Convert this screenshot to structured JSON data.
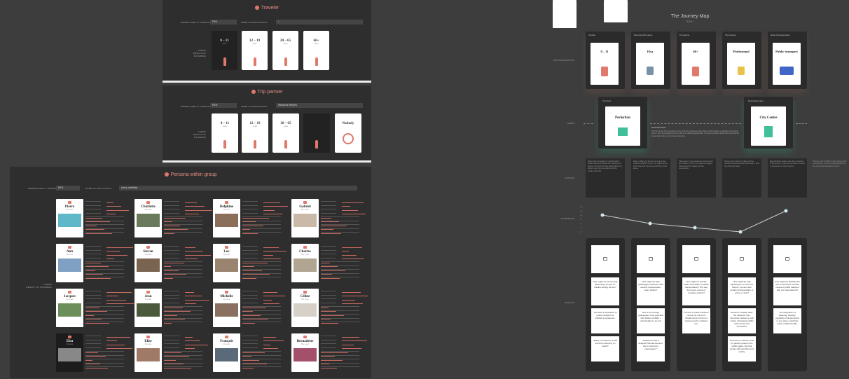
{
  "traveler": {
    "title": "Traveler",
    "field1_label": "WHERE DOES IT HAPPEN",
    "field1_value": "FED",
    "field2_label": "NAME OF PARTICIPANT",
    "field2_value": "/",
    "side_label": "CARDS",
    "side_sub": "RESULT OF FILTERING",
    "cards": [
      {
        "age": "0 – 11",
        "unit": "years",
        "dark": true
      },
      {
        "age": "12 – 19",
        "unit": "years",
        "dark": false
      },
      {
        "age": "20 – 65",
        "unit": "years",
        "dark": false
      },
      {
        "age": "66+",
        "unit": "years",
        "dark": false
      }
    ]
  },
  "trip_partner": {
    "title": "Trip partner",
    "field1_label": "WHERE DOES IT HAPPEN",
    "field1_value": "RED",
    "field2_label": "NAME OF PARTICIPANT",
    "field2_value": "Marianne Meyers",
    "side_label": "CARDS",
    "side_sub": "RESULT OF FILTERING",
    "cards": [
      {
        "age": "0 – 11",
        "unit": "years",
        "dark": false
      },
      {
        "age": "12 – 19",
        "unit": "years",
        "dark": false
      },
      {
        "age": "20 – 65",
        "unit": "years",
        "dark": false
      },
      {
        "age": "",
        "unit": "",
        "dark": true
      },
      {
        "age": "Nobody",
        "unit": "",
        "dark": false
      }
    ]
  },
  "persona": {
    "title": "Persona within group",
    "field1_label": "WHERE DOES IT HAPPEN",
    "field1_value": "RED",
    "field2_label": "NAME OF PARTICIPANT",
    "field2_value": "Anna_dekthian",
    "side_label": "CARDS",
    "side_sub": "RESULT OF FILTERING",
    "people": [
      {
        "name": "Pierre",
        "age": "35 years"
      },
      {
        "name": "Charlotte",
        "age": "55 years"
      },
      {
        "name": "Delphine",
        "age": "42 years"
      },
      {
        "name": "Gabriel",
        "age": "66+ years"
      },
      {
        "name": "Ann",
        "age": "48 years"
      },
      {
        "name": "Steven",
        "age": "40 years"
      },
      {
        "name": "Luc",
        "age": "60 years"
      },
      {
        "name": "Charles",
        "age": "66+ years"
      },
      {
        "name": "Jacques",
        "age": "50 years"
      },
      {
        "name": "Jean",
        "age": "30 years"
      },
      {
        "name": "Michelle",
        "age": "39 years"
      },
      {
        "name": "Céline",
        "age": "66+ years"
      },
      {
        "name": "Elsa",
        "age": "29 years"
      },
      {
        "name": "Elise",
        "age": "25 years"
      },
      {
        "name": "François",
        "age": "31 years"
      },
      {
        "name": "Bernadette",
        "age": "66+ years"
      }
    ]
  },
  "journey": {
    "title": "The Journey Map",
    "subtitle": "TEAM 1",
    "row_labels": [
      "TRIP INFORMATIONS",
      "NEEDS",
      "ACTIONS",
      "EXPERIENCE",
      "INSIGHTS"
    ],
    "info_cards": [
      {
        "head": "Traveler",
        "main": "0 – 11"
      },
      {
        "head": "Persona within group",
        "main": "Elsa"
      },
      {
        "head": "Trip partner",
        "main": "66+"
      },
      {
        "head": "Trip purpose",
        "main": "Professional"
      },
      {
        "head": "Mode of transportation",
        "main": "Public transport"
      }
    ],
    "start_head": "Trip start",
    "start_label": "Periurban",
    "end_head": "Destination area",
    "end_label": "City Centre",
    "description_label": "DESCRIPTION",
    "description_text": "The 60 min trip from periurban to city centre for a business day. Elsa and her partner a neighbour and senior citizen, who is accompanying the child to a medical appointment. The journey begins at the bus stop near the house and ends at a tram stop downtown.",
    "actions": [
      "Elsa's care companion is worried about public transport because the frequency of buses is low and she has doubts about her ability to get into the vehicle with the stroller and child.",
      "Elsa is waiting for the bus on a rainy day without a shelter. There is no real-time info at the stop and she cannot tell when it will arrive.",
      "Passengers in the passenger environment are hesitant. There is no real-time display inside about the delays and the connections.",
      "During the trip there is traffic and the vehicle becomes crowded. Elsa has to hold her child and stand.",
      "Elsa decided to take a ride with a member of the journey. There are no rails to connect to a local taxi or other options.",
      "There is a lot of traffic on the transport line to downtown; it is a few stops ahead and the crowd pushes Elsa to the exit."
    ],
    "insights_top": [
      "How might we ensure that Elsa keeps an eye on children during the trip?",
      "How might we help passengers interleave with another transportation when delays?",
      "How might we provide better information in public transportation? The way they book, access & compare options?",
      "How might we help passengers on real time before / connect with another transportation to arrive on time?",
      "How might we facilitate the use & connection of other means of public transport with our local stations?"
    ],
    "insights_mid": [
      "The lack of separation of public transport for children's experience.",
      "How to encourage passengers to be punctual with shared mobility + what budget to do so?",
      "Comfort in public transport comes not only from infrastructure but from a human touch on shared use.",
      "Access to mobility hubs, the transition from motorized vehicles to soft modes of transport within urban areas was successful.",
      "The integration of planning, booking, payability of all transports in one place could help make mobility flexible."
    ],
    "insights_bot": [
      "Safety in transport: would there be a security on board?",
      "Additional costs if delayed? Reimbursement, taxi or refund for passengers?",
      "",
      "That there is still the need for parking space in the public space. But that people still want their cars nearby.",
      ""
    ],
    "experience_values": [
      1,
      -1,
      -2,
      -3,
      2
    ]
  }
}
